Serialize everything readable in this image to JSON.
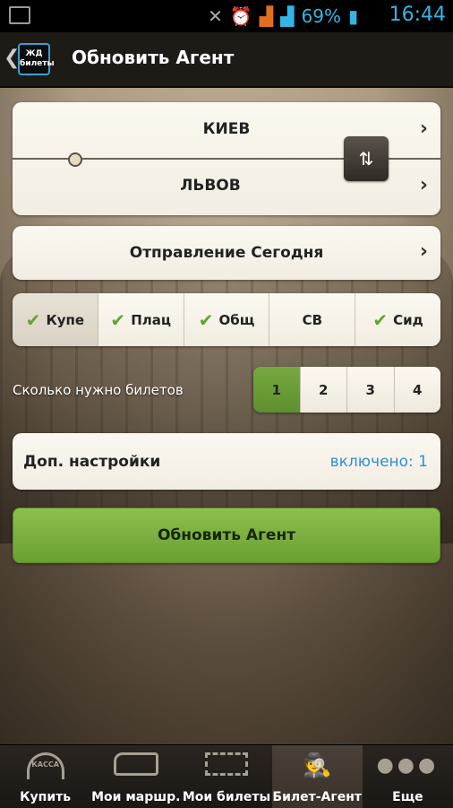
{
  "status_bar": {
    "battery_percent": "69%",
    "time": "16:44"
  },
  "action_bar": {
    "back_glyph": "❮",
    "logo_text": "ЖД билеты",
    "title": "Обновить Агент"
  },
  "route": {
    "from": "КИЕВ",
    "to": "ЛЬВОВ",
    "swap_glyph": "⇅",
    "chevron": "›"
  },
  "departure": {
    "label": "Отправление Сегодня"
  },
  "classes": [
    {
      "label": "Купе",
      "checked": true
    },
    {
      "label": "Плац",
      "checked": true
    },
    {
      "label": "Общ",
      "checked": true
    },
    {
      "label": "СВ",
      "checked": false
    },
    {
      "label": "Сид",
      "checked": true
    }
  ],
  "tickets": {
    "label": "Сколько нужно билетов",
    "options": [
      "1",
      "2",
      "3",
      "4"
    ],
    "selected": "1"
  },
  "extra_settings": {
    "label": "Доп. настройки",
    "value": "включено: 1"
  },
  "main_button": {
    "label": "Обновить Агент"
  },
  "tab_bar": {
    "tabs": [
      {
        "label": "Купить",
        "icon": "kassa-icon",
        "icon_text": "КАССА",
        "active": false
      },
      {
        "label": "Мои маршр.",
        "icon": "train-icon",
        "active": false
      },
      {
        "label": "Мои билеты",
        "icon": "ticket-icon",
        "active": false
      },
      {
        "label": "Билет-Агент",
        "icon": "agent-icon",
        "active": true
      },
      {
        "label": "Еще",
        "icon": "more-icon",
        "active": false
      }
    ]
  },
  "colors": {
    "accent_green": "#7cb342",
    "link_blue": "#2a8fd6",
    "status_blue": "#33b5e5"
  }
}
